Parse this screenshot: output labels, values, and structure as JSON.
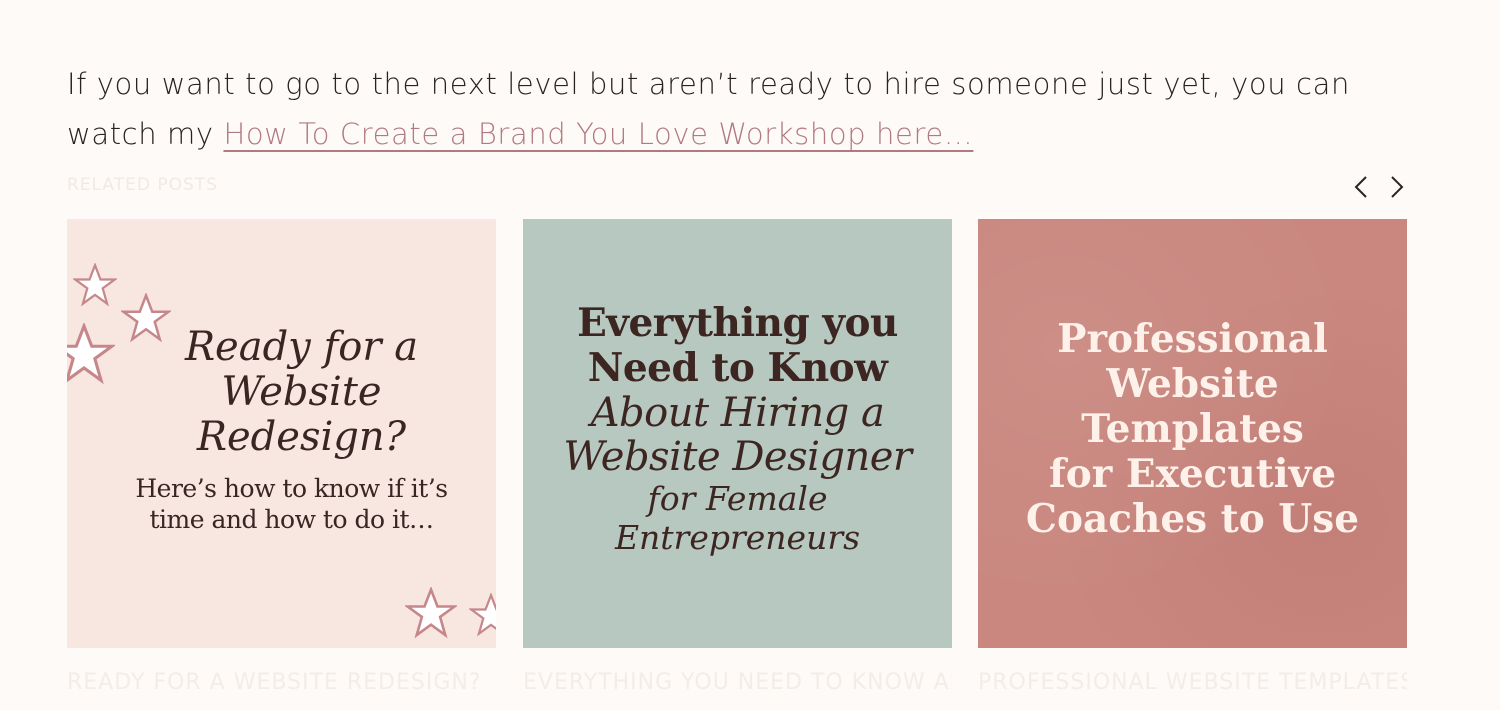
{
  "intro": {
    "text": "If you want to go to the next level but aren’t ready to hire someone just yet, you can watch my ",
    "link_text": "How To Create a Brand You Love Workshop here…"
  },
  "related": {
    "label": "RELATED POSTS",
    "prev_icon": "chevron-left-icon",
    "next_icon": "chevron-right-icon",
    "cards": [
      {
        "heading": [
          "Ready for a",
          "Website",
          "Redesign?"
        ],
        "sub": [
          "Here’s how to know if it’s",
          "time and how to do it…"
        ],
        "caption": "READY FOR A WEBSITE REDESIGN?"
      },
      {
        "heading": [
          "Everything you",
          "Need to Know"
        ],
        "italic": [
          "About Hiring a",
          "Website Designer"
        ],
        "italic_small": [
          "for Female",
          "Entrepreneurs"
        ],
        "caption": "EVERYTHING YOU NEED TO KNOW ABOUT"
      },
      {
        "heading": [
          "Professional",
          "Website",
          "Templates",
          "for Executive",
          "Coaches to Use"
        ],
        "caption": "PROFESSIONAL WEBSITE TEMPLATES FOR"
      }
    ]
  },
  "colors": {
    "background": "#fefaf7",
    "link": "#b07a80",
    "card1": "#f8e6e1",
    "card2": "#b6c8bf",
    "card3": "#c9877f"
  }
}
